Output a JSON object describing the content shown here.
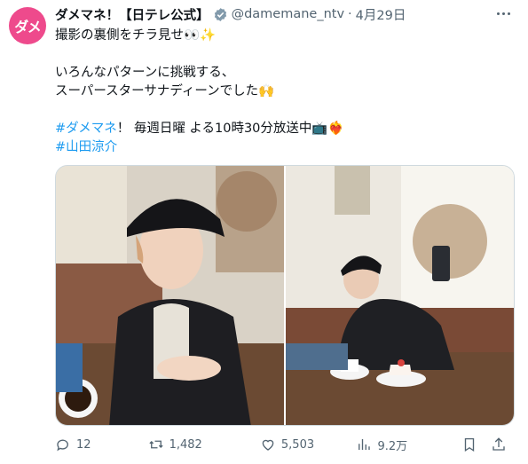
{
  "tweet": {
    "avatar_text": "ダメ",
    "display_name": "ダメマネ！【日テレ公式】",
    "handle": "@damemane_ntv",
    "separator": "·",
    "date": "4月29日",
    "lines": [
      "撮影の裏側をチラ見せ👀✨",
      "いろんなパターンに挑戦する、",
      "スーパースターサナディーンでした🙌",
      "毎週日曜 よる10時30分放送中📺❤️‍🔥"
    ],
    "hashtag1": "#ダメマネ",
    "hashtag1_suffix": "！",
    "hashtag2": "#山田涼介"
  },
  "actions": {
    "reply_count": "12",
    "retweet_count": "1,482",
    "like_count": "5,503",
    "views_count": "9.2万"
  },
  "colors": {
    "accent": "#1d9bf0",
    "avatar_bg": "#ee4a8c",
    "muted": "#536471"
  }
}
